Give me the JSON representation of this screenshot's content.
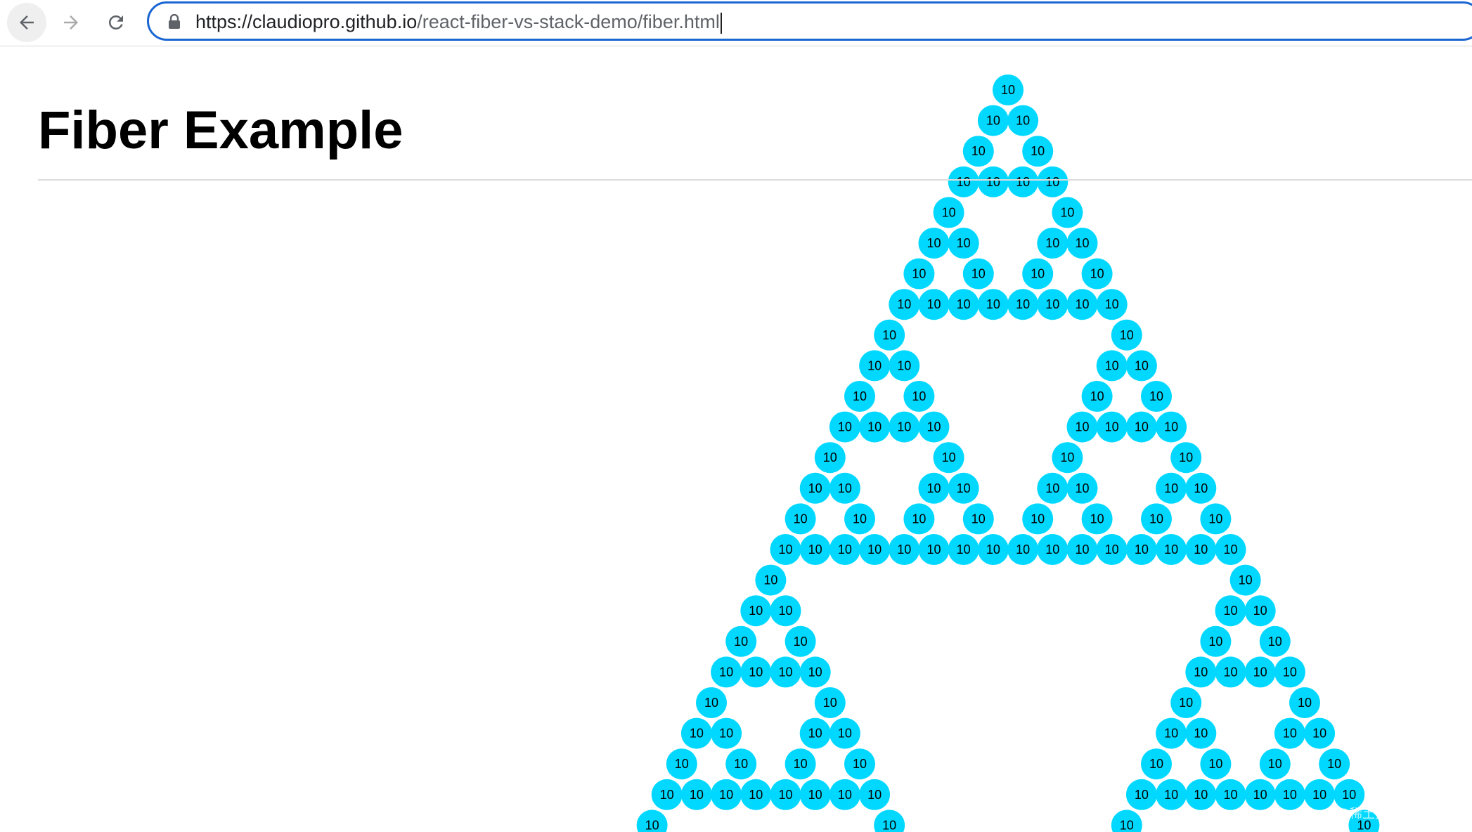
{
  "browser": {
    "url_host": "https://claudiopro.github.io",
    "url_path": "/react-fiber-vs-stack-demo/fiber.html",
    "icons": {
      "back": "arrow-left-icon",
      "forward": "arrow-right-icon",
      "reload": "reload-icon",
      "secure": "lock-icon"
    }
  },
  "page": {
    "title": "Fiber Example"
  },
  "triangle": {
    "dot_label": "10",
    "dot_color": "#00d8ff"
  },
  "watermark": "@稀土掘金技术社区"
}
